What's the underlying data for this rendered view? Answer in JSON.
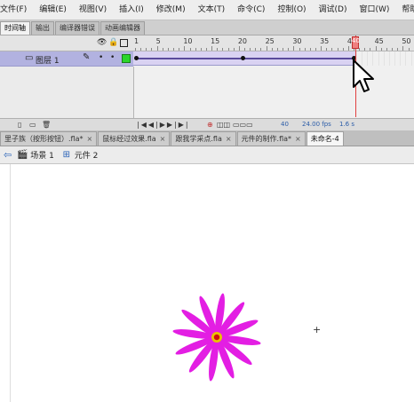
{
  "menubar": {
    "items": [
      "文件(F)",
      "编辑(E)",
      "视图(V)",
      "插入(I)",
      "修改(M)",
      "文本(T)",
      "命令(C)",
      "控制(O)",
      "调试(D)",
      "窗口(W)",
      "帮助"
    ]
  },
  "panel_tabs": [
    "时间轴",
    "输出",
    "编译器错误",
    "动画编辑器"
  ],
  "timeline": {
    "ruler_numbers": [
      "1",
      "5",
      "10",
      "15",
      "20",
      "25",
      "30",
      "35",
      "40",
      "45",
      "50"
    ],
    "layer_name": "图层 1",
    "current_frame": "40",
    "fps": "24.00 fps",
    "elapsed": "1.6 s"
  },
  "doc_tabs": [
    {
      "label": "里子族（按形按钮）.fla*",
      "active": false
    },
    {
      "label": "鼠标经过效果.fla",
      "active": false
    },
    {
      "label": "跟我学采点.fla",
      "active": false
    },
    {
      "label": "元件的制作.fla*",
      "active": false
    },
    {
      "label": "未命名-4",
      "active": true
    }
  ],
  "breadcrumb": {
    "scene": "场景 1",
    "symbol": "元件 2"
  },
  "colors": {
    "petal": "#e31ee3",
    "center_ring": "#e8c400",
    "center_core": "#d01010"
  }
}
